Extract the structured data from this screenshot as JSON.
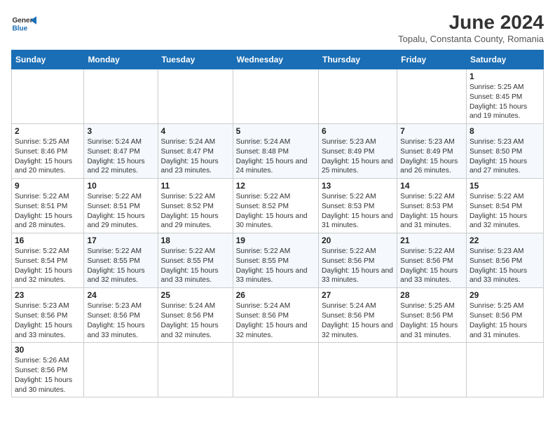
{
  "logo": {
    "general": "General",
    "blue": "Blue"
  },
  "title": "June 2024",
  "subtitle": "Topalu, Constanta County, Romania",
  "weekdays": [
    "Sunday",
    "Monday",
    "Tuesday",
    "Wednesday",
    "Thursday",
    "Friday",
    "Saturday"
  ],
  "weeks": [
    [
      {
        "day": "",
        "info": ""
      },
      {
        "day": "",
        "info": ""
      },
      {
        "day": "",
        "info": ""
      },
      {
        "day": "",
        "info": ""
      },
      {
        "day": "",
        "info": ""
      },
      {
        "day": "",
        "info": ""
      },
      {
        "day": "1",
        "info": "Sunrise: 5:25 AM\nSunset: 8:45 PM\nDaylight: 15 hours and 19 minutes."
      }
    ],
    [
      {
        "day": "2",
        "info": "Sunrise: 5:25 AM\nSunset: 8:46 PM\nDaylight: 15 hours and 20 minutes."
      },
      {
        "day": "3",
        "info": "Sunrise: 5:24 AM\nSunset: 8:47 PM\nDaylight: 15 hours and 22 minutes."
      },
      {
        "day": "4",
        "info": "Sunrise: 5:24 AM\nSunset: 8:47 PM\nDaylight: 15 hours and 23 minutes."
      },
      {
        "day": "5",
        "info": "Sunrise: 5:24 AM\nSunset: 8:48 PM\nDaylight: 15 hours and 24 minutes."
      },
      {
        "day": "6",
        "info": "Sunrise: 5:23 AM\nSunset: 8:49 PM\nDaylight: 15 hours and 25 minutes."
      },
      {
        "day": "7",
        "info": "Sunrise: 5:23 AM\nSunset: 8:49 PM\nDaylight: 15 hours and 26 minutes."
      },
      {
        "day": "8",
        "info": "Sunrise: 5:23 AM\nSunset: 8:50 PM\nDaylight: 15 hours and 27 minutes."
      }
    ],
    [
      {
        "day": "9",
        "info": "Sunrise: 5:22 AM\nSunset: 8:51 PM\nDaylight: 15 hours and 28 minutes."
      },
      {
        "day": "10",
        "info": "Sunrise: 5:22 AM\nSunset: 8:51 PM\nDaylight: 15 hours and 29 minutes."
      },
      {
        "day": "11",
        "info": "Sunrise: 5:22 AM\nSunset: 8:52 PM\nDaylight: 15 hours and 29 minutes."
      },
      {
        "day": "12",
        "info": "Sunrise: 5:22 AM\nSunset: 8:52 PM\nDaylight: 15 hours and 30 minutes."
      },
      {
        "day": "13",
        "info": "Sunrise: 5:22 AM\nSunset: 8:53 PM\nDaylight: 15 hours and 31 minutes."
      },
      {
        "day": "14",
        "info": "Sunrise: 5:22 AM\nSunset: 8:53 PM\nDaylight: 15 hours and 31 minutes."
      },
      {
        "day": "15",
        "info": "Sunrise: 5:22 AM\nSunset: 8:54 PM\nDaylight: 15 hours and 32 minutes."
      }
    ],
    [
      {
        "day": "16",
        "info": "Sunrise: 5:22 AM\nSunset: 8:54 PM\nDaylight: 15 hours and 32 minutes."
      },
      {
        "day": "17",
        "info": "Sunrise: 5:22 AM\nSunset: 8:55 PM\nDaylight: 15 hours and 32 minutes."
      },
      {
        "day": "18",
        "info": "Sunrise: 5:22 AM\nSunset: 8:55 PM\nDaylight: 15 hours and 33 minutes."
      },
      {
        "day": "19",
        "info": "Sunrise: 5:22 AM\nSunset: 8:55 PM\nDaylight: 15 hours and 33 minutes."
      },
      {
        "day": "20",
        "info": "Sunrise: 5:22 AM\nSunset: 8:56 PM\nDaylight: 15 hours and 33 minutes."
      },
      {
        "day": "21",
        "info": "Sunrise: 5:22 AM\nSunset: 8:56 PM\nDaylight: 15 hours and 33 minutes."
      },
      {
        "day": "22",
        "info": "Sunrise: 5:23 AM\nSunset: 8:56 PM\nDaylight: 15 hours and 33 minutes."
      }
    ],
    [
      {
        "day": "23",
        "info": "Sunrise: 5:23 AM\nSunset: 8:56 PM\nDaylight: 15 hours and 33 minutes."
      },
      {
        "day": "24",
        "info": "Sunrise: 5:23 AM\nSunset: 8:56 PM\nDaylight: 15 hours and 33 minutes."
      },
      {
        "day": "25",
        "info": "Sunrise: 5:24 AM\nSunset: 8:56 PM\nDaylight: 15 hours and 32 minutes."
      },
      {
        "day": "26",
        "info": "Sunrise: 5:24 AM\nSunset: 8:56 PM\nDaylight: 15 hours and 32 minutes."
      },
      {
        "day": "27",
        "info": "Sunrise: 5:24 AM\nSunset: 8:56 PM\nDaylight: 15 hours and 32 minutes."
      },
      {
        "day": "28",
        "info": "Sunrise: 5:25 AM\nSunset: 8:56 PM\nDaylight: 15 hours and 31 minutes."
      },
      {
        "day": "29",
        "info": "Sunrise: 5:25 AM\nSunset: 8:56 PM\nDaylight: 15 hours and 31 minutes."
      }
    ],
    [
      {
        "day": "30",
        "info": "Sunrise: 5:26 AM\nSunset: 8:56 PM\nDaylight: 15 hours and 30 minutes."
      },
      {
        "day": "",
        "info": ""
      },
      {
        "day": "",
        "info": ""
      },
      {
        "day": "",
        "info": ""
      },
      {
        "day": "",
        "info": ""
      },
      {
        "day": "",
        "info": ""
      },
      {
        "day": "",
        "info": ""
      }
    ]
  ]
}
